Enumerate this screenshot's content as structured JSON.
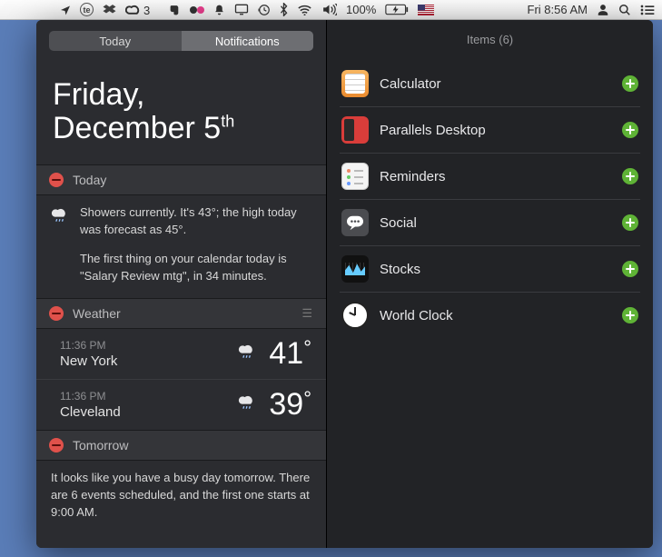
{
  "menubar": {
    "creative_cloud_badge": "3",
    "battery_percent": "100%",
    "datetime": "Fri 8:56 AM"
  },
  "tabs": {
    "today": "Today",
    "notifications": "Notifications"
  },
  "date_header": {
    "line1": "Friday,",
    "line2_month": "December 5",
    "ordinal": "th"
  },
  "sections": {
    "today": {
      "title": "Today",
      "weather_line": "Showers currently. It's 43°; the high today was forecast as 45°.",
      "calendar_line": "The first thing on your calendar today is \"Salary Review mtg\", in 34 minutes."
    },
    "weather": {
      "title": "Weather",
      "cities": [
        {
          "time": "11:36 PM",
          "city": "New York",
          "temp": "41",
          "deg": "°"
        },
        {
          "time": "11:36 PM",
          "city": "Cleveland",
          "temp": "39",
          "deg": "°"
        }
      ]
    },
    "tomorrow": {
      "title": "Tomorrow",
      "text": "It looks like you have a busy day tomorrow. There are 6 events scheduled, and the first one starts at 9:00 AM."
    }
  },
  "items_panel": {
    "header": "Items (6)",
    "items": [
      {
        "label": "Calculator",
        "icon": "calculator-icon"
      },
      {
        "label": "Parallels Desktop",
        "icon": "parallels-icon"
      },
      {
        "label": "Reminders",
        "icon": "reminders-icon"
      },
      {
        "label": "Social",
        "icon": "social-icon"
      },
      {
        "label": "Stocks",
        "icon": "stocks-icon"
      },
      {
        "label": "World Clock",
        "icon": "world-clock-icon"
      }
    ]
  }
}
